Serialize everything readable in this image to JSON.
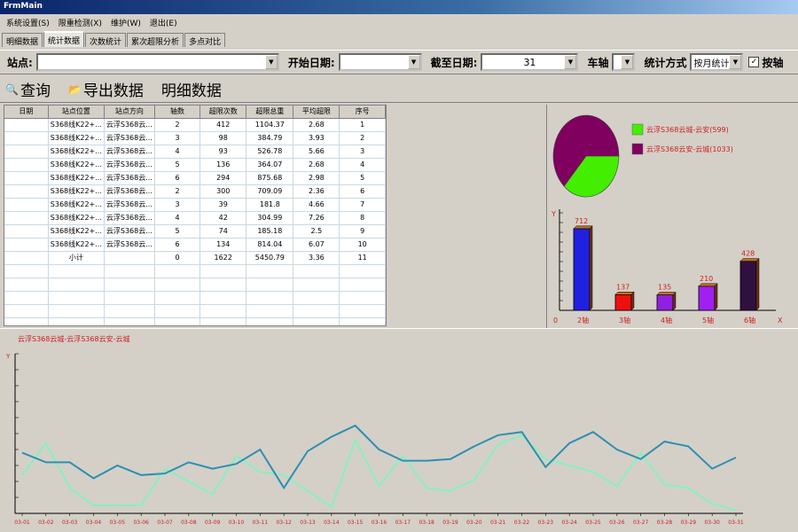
{
  "window": {
    "title": "FrmMain"
  },
  "menu": [
    "系统设置(S)",
    "限重检测(X)",
    "维护(W)",
    "退出(E)"
  ],
  "tabs": [
    {
      "label": "明细数据",
      "active": false
    },
    {
      "label": "统计数据",
      "active": true
    },
    {
      "label": "次数统计",
      "active": false
    },
    {
      "label": "累次超限分析",
      "active": false
    },
    {
      "label": "多点对比",
      "active": false
    }
  ],
  "filters": {
    "station_label": "站点:",
    "station_value": "",
    "start_label": "开始日期:",
    "start_value": "",
    "end_label": "截至日期:",
    "end_value": "31",
    "axle_label": "车轴",
    "axle_value": "",
    "method_label": "统计方式",
    "method_value": "按月统计",
    "by_axle_label": "按轴",
    "by_axle_checked": true
  },
  "toolbar": {
    "query": "查询",
    "export": "导出数据",
    "detail": "明细数据"
  },
  "table": {
    "headers": [
      "日期",
      "站点位置",
      "站点方向",
      "轴数",
      "超限次数",
      "超限总重",
      "平均超限",
      "序号"
    ],
    "rows": [
      [
        "",
        "S368线K22+...",
        "云浮S368云...",
        "2",
        "412",
        "1104.37",
        "2.68",
        "1"
      ],
      [
        "",
        "S368线K22+...",
        "云浮S368云...",
        "3",
        "98",
        "384.79",
        "3.93",
        "2"
      ],
      [
        "",
        "S368线K22+...",
        "云浮S368云...",
        "4",
        "93",
        "526.78",
        "5.66",
        "3"
      ],
      [
        "",
        "S368线K22+...",
        "云浮S368云...",
        "5",
        "136",
        "364.07",
        "2.68",
        "4"
      ],
      [
        "",
        "S368线K22+...",
        "云浮S368云...",
        "6",
        "294",
        "875.68",
        "2.98",
        "5"
      ],
      [
        "",
        "S368线K22+...",
        "云浮S368云...",
        "2",
        "300",
        "709.09",
        "2.36",
        "6"
      ],
      [
        "",
        "S368线K22+...",
        "云浮S368云...",
        "3",
        "39",
        "181.8",
        "4.66",
        "7"
      ],
      [
        "",
        "S368线K22+...",
        "云浮S368云...",
        "4",
        "42",
        "304.99",
        "7.26",
        "8"
      ],
      [
        "",
        "S368线K22+...",
        "云浮S368云...",
        "5",
        "74",
        "185.18",
        "2.5",
        "9"
      ],
      [
        "",
        "S368线K22+...",
        "云浮S368云...",
        "6",
        "134",
        "814.04",
        "6.07",
        "10"
      ],
      [
        "",
        "小计",
        "",
        "0",
        "1622",
        "5450.79",
        "3.36",
        "11"
      ]
    ],
    "empty_rows": 5
  },
  "chart_data": [
    {
      "type": "pie",
      "labels": [
        "云浮S368云城-云安(599)",
        "云浮S368云安-云城(1033)"
      ],
      "values": [
        599,
        1033
      ],
      "colors": [
        "#44ee00",
        "#800060"
      ]
    },
    {
      "type": "bar",
      "categories": [
        "2轴",
        "3轴",
        "4轴",
        "5轴",
        "6轴"
      ],
      "values": [
        712,
        137,
        135,
        210,
        428
      ],
      "colors": [
        "#2020e0",
        "#ee1010",
        "#9020e0",
        "#a020f0",
        "#301040"
      ],
      "ylim": [
        0,
        850
      ],
      "ylabel": "Y",
      "xlabel": "X",
      "origin_label": "0"
    },
    {
      "type": "line",
      "title": "云浮S368云城-云浮S368云安-云城",
      "ylabel": "Y",
      "x": [
        "03-01",
        "03-02",
        "03-03",
        "03-04",
        "03-05",
        "03-06",
        "03-07",
        "03-08",
        "03-09",
        "03-10",
        "03-11",
        "03-12",
        "03-13",
        "03-14",
        "03-15",
        "03-16",
        "03-17",
        "03-18",
        "03-19",
        "03-20",
        "03-21",
        "03-22",
        "03-23",
        "03-24",
        "03-25",
        "03-26",
        "03-27",
        "03-28",
        "03-29",
        "03-30",
        "03-31"
      ],
      "ylim": [
        0,
        100
      ],
      "series": [
        {
          "color": "#2e8fb0",
          "values": [
            38,
            32,
            32,
            22,
            30,
            24,
            25,
            32,
            28,
            31,
            40,
            16,
            39,
            48,
            55,
            40,
            33,
            33,
            34,
            42,
            49,
            51,
            29,
            44,
            51,
            40,
            34,
            45,
            42,
            28,
            35
          ]
        },
        {
          "color": "#88f0c0",
          "values": [
            24,
            44,
            16,
            5,
            5,
            5,
            28,
            20,
            12,
            36,
            26,
            24,
            14,
            4,
            46,
            17,
            36,
            16,
            14,
            21,
            43,
            49,
            34,
            30,
            26,
            17,
            38,
            18,
            16,
            6,
            2
          ]
        }
      ]
    }
  ]
}
